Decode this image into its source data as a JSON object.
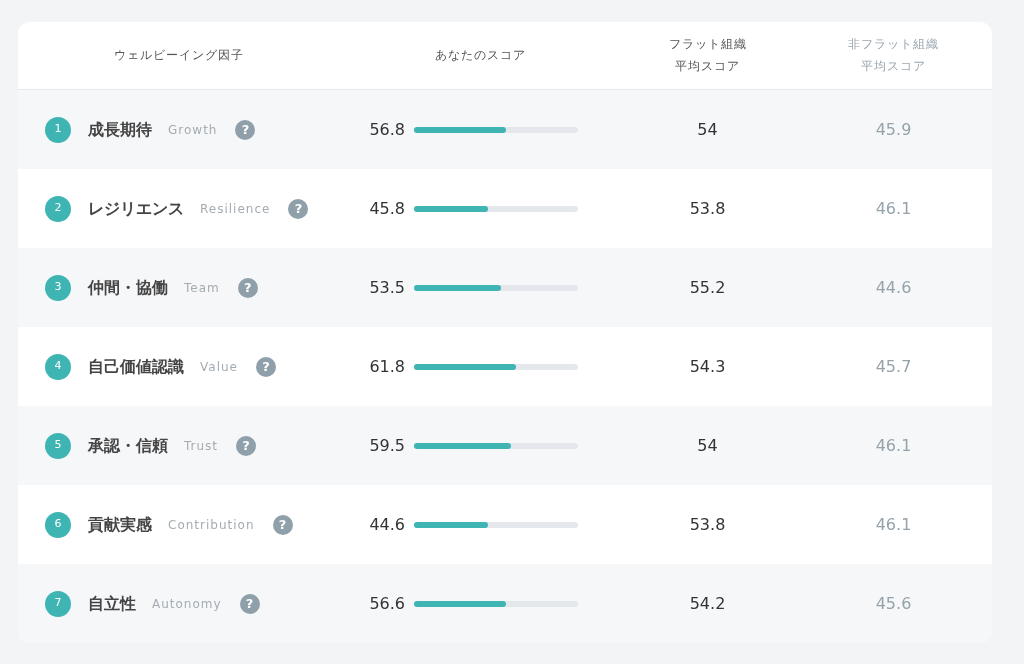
{
  "table": {
    "columns": [
      {
        "label": "ウェルビーイング因子"
      },
      {
        "label": "あなたのスコア"
      },
      {
        "lines": [
          "フラット組織",
          "平均スコア"
        ]
      },
      {
        "lines": [
          "非フラット組織",
          "平均スコア"
        ]
      }
    ],
    "rows": [
      {
        "number": "1",
        "name": "成長期待",
        "english": "Growth",
        "help": "?",
        "score": "56.8",
        "level": 0.56,
        "flat": "54",
        "non_flat": "45.9"
      },
      {
        "number": "2",
        "name": "レジリエンス",
        "english": "Resilience",
        "help": "?",
        "score": "45.8",
        "level": 0.45,
        "flat": "53.8",
        "non_flat": "46.1"
      },
      {
        "number": "3",
        "name": "仲間・協働",
        "english": "Team",
        "help": "?",
        "score": "53.5",
        "level": 0.53,
        "flat": "55.2",
        "non_flat": "44.6"
      },
      {
        "number": "4",
        "name": "自己価値認識",
        "english": "Value",
        "help": "?",
        "score": "61.8",
        "level": 0.62,
        "flat": "54.3",
        "non_flat": "45.7"
      },
      {
        "number": "5",
        "name": "承認・信頼",
        "english": "Trust",
        "help": "?",
        "score": "59.5",
        "level": 0.59,
        "flat": "54",
        "non_flat": "46.1"
      },
      {
        "number": "6",
        "name": "貢献実感",
        "english": "Contribution",
        "help": "?",
        "score": "44.6",
        "level": 0.45,
        "flat": "53.8",
        "non_flat": "46.1"
      },
      {
        "number": "7",
        "name": "自立性",
        "english": "Autonomy",
        "help": "?",
        "score": "56.6",
        "level": 0.56,
        "flat": "54.2",
        "non_flat": "45.6"
      }
    ]
  }
}
